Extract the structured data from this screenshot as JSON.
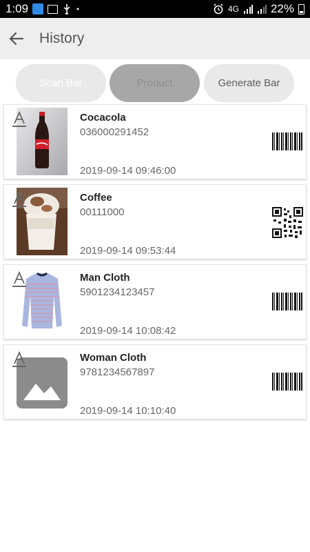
{
  "status_bar": {
    "time": "1:09",
    "network": "4G",
    "battery": "22%"
  },
  "app_bar": {
    "back_icon": "arrow-left-icon",
    "title": "History"
  },
  "tabs": [
    {
      "label": "Scan Bar"
    },
    {
      "label": "Product"
    },
    {
      "label": "Generate Bar"
    }
  ],
  "history": [
    {
      "name": "Cocacola",
      "code": "036000291452",
      "date": "2019-09-14 09:46:00",
      "thumb": "cola-bottle-photo",
      "code_type": "barcode-icon"
    },
    {
      "name": "Coffee",
      "code": "00111000",
      "date": "2019-09-14 09:53:44",
      "thumb": "coffee-cup-photo",
      "code_type": "qr-code-icon"
    },
    {
      "name": "Man Cloth",
      "code": "5901234123457",
      "date": "2019-09-14 10:08:42",
      "thumb": "sweater-photo",
      "code_type": "barcode-icon"
    },
    {
      "name": "Woman Cloth",
      "code": "9781234567897",
      "date": "2019-09-14 10:10:40",
      "thumb": "image-placeholder-icon",
      "code_type": "barcode-icon"
    }
  ],
  "colors": {
    "app_bar_bg": "#eeeeee",
    "selected_tab": "#a7a7a7",
    "unselected_tab": "#e9e9e9"
  }
}
